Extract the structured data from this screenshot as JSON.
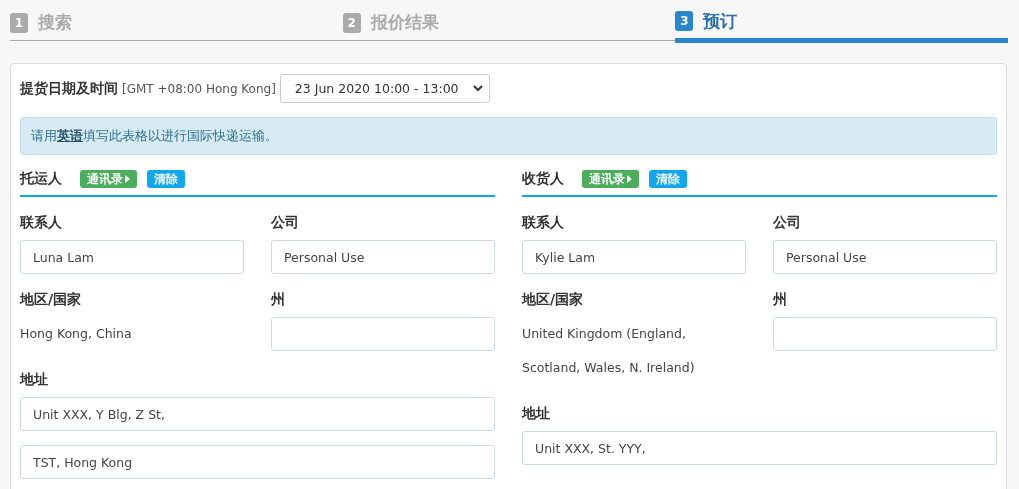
{
  "steps": [
    {
      "number": "1",
      "label": "搜索",
      "selected": false
    },
    {
      "number": "2",
      "label": "报价结果",
      "selected": false
    },
    {
      "number": "3",
      "label": "预订",
      "selected": true
    }
  ],
  "pickup": {
    "label": "提货日期及时间",
    "timezone": "[GMT +08:00 Hong Kong]",
    "value": "23 Jun 2020 10:00 - 13:00"
  },
  "notice": "请用**英语**填写此表格以进行国际快递运输。",
  "parties": [
    {
      "title": "托运人",
      "buttons": [
        {
          "label": "通讯录",
          "kind": "contacts"
        },
        {
          "label": "清除",
          "kind": "clear"
        }
      ],
      "contact_label": "联系人",
      "contact": "Luna Lam",
      "company_label": "公司",
      "company": "Personal Use",
      "region_label": "地区/国家",
      "region": [
        "Hong Kong, China"
      ],
      "state_label": "州",
      "address_label": "地址",
      "address": [
        "Unit XXX, Y Blg, Z St,",
        "TST, Hong Kong"
      ]
    },
    {
      "title": "收货人",
      "buttons": [
        {
          "label": "通讯录",
          "kind": "contacts"
        },
        {
          "label": "清除",
          "kind": "clear"
        }
      ],
      "contact_label": "联系人",
      "contact": "Kylie Lam",
      "company_label": "公司",
      "company": "Personal Use",
      "region_label": "地区/国家",
      "region": [
        "United Kingdom (England,",
        "Scotland, Wales, N. Ireland)"
      ],
      "state_label": "州",
      "address_label": "地址",
      "address": [
        "Unit XXX, St. YYY,"
      ]
    }
  ]
}
